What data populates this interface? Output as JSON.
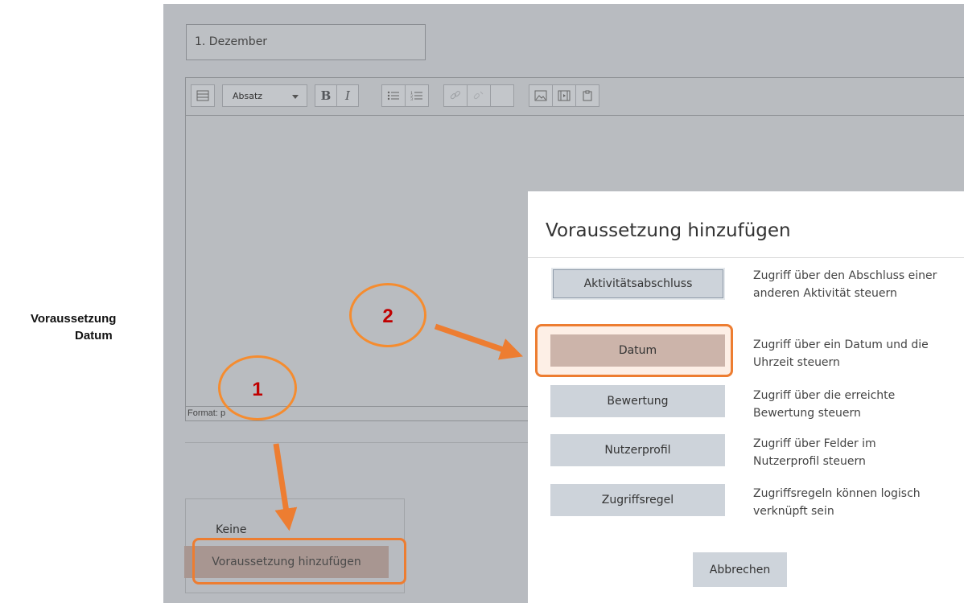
{
  "caption": {
    "line1": "Voraussetzung",
    "line2": "Datum"
  },
  "form": {
    "title_value": "1. Dezember",
    "toolbar": {
      "format_select": "Absatz",
      "bold_label": "B",
      "italic_label": "I"
    },
    "status_bar": "Format: p",
    "restriction": {
      "none_label": "Keine",
      "add_button": "Voraussetzung hinzufügen"
    }
  },
  "modal": {
    "title": "Voraussetzung hinzufügen",
    "options": [
      {
        "label": "Aktivitätsabschluss",
        "description": "Zugriff über den Abschluss einer anderen Aktivität steuern"
      },
      {
        "label": "Datum",
        "description": "Zugriff über ein Datum und die Uhrzeit steuern"
      },
      {
        "label": "Bewertung",
        "description": "Zugriff über die erreichte Bewertung steuern"
      },
      {
        "label": "Nutzerprofil",
        "description": "Zugriff über Felder im Nutzerprofil steuern"
      },
      {
        "label": "Zugriffsregel",
        "description": "Zugriffsregeln können logisch verknüpft sein"
      }
    ],
    "cancel_button": "Abbrechen"
  },
  "annotations": {
    "step1": "1",
    "step2": "2",
    "highlight_color": "#ed7d31",
    "number_color": "#c00000"
  }
}
